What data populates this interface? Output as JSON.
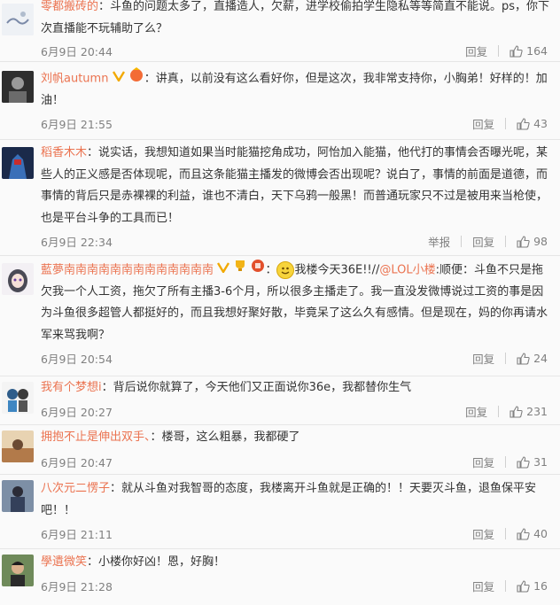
{
  "comments": [
    {
      "user": "零都搬砖的",
      "text": "：斗鱼的问题太多了，直播造人，欠薪，进学校偷拍学生隐私等等简直不能说。ps，你下次直播能不玩辅助了么？",
      "date": "6月9日 20:44",
      "report": "",
      "reply": "回复",
      "likes": "164"
    },
    {
      "user": "刘帆autumn",
      "text": "：讲真，以前没有这么看好你，但是这次，我非常支持你，小胸弟！好样的！加油！",
      "date": "6月9日 21:55",
      "report": "",
      "reply": "回复",
      "likes": "43"
    },
    {
      "user": "稻香木木",
      "text": "：说实话，我想知道如果当时能猫挖角成功，阿怡加入能猫，他代打的事情会否曝光呢，某些人的正义感是否体现呢，而且这条能猫主播发的微博会否出现呢？说白了，事情的前面是道德，而事情的背后只是赤裸裸的利益，谁也不清白，天下乌鸦一般黑！而普通玩家只不过是被用来当枪使，也是平台斗争的工具而已！",
      "date": "6月9日 22:34",
      "report": "举报",
      "reply": "回复",
      "likes": "98"
    },
    {
      "user": "藍夢南南南南南南南南南南南南南",
      "pre": "：",
      "text_a": "我楼今天36E!!//",
      "mention": "@LOL小楼",
      "text": ":顺便：斗鱼不只是拖欠我一个人工资，拖欠了所有主播3-6个月，所以很多主播走了。我一直没发微博说过工资的事是因为斗鱼很多超管人都挺好的，而且我想好聚好散，毕竟呆了这么久有感情。但是现在，妈的你再请水军来骂我啊？",
      "date": "6月9日 20:54",
      "report": "",
      "reply": "回复",
      "likes": "24"
    },
    {
      "user": "我有个梦想i",
      "text": "：背后说你就算了，今天他们又正面说你36e，我都替你生气",
      "date": "6月9日 20:27",
      "report": "",
      "reply": "回复",
      "likes": "231"
    },
    {
      "user": "拥抱不止是伸出双手、",
      "text": "：楼哥，这么粗暴，我都硬了",
      "date": "6月9日 20:47",
      "report": "",
      "reply": "回复",
      "likes": "31"
    },
    {
      "user": "八次元二愣子",
      "text": "：就从斗鱼对我智哥的态度，我楼离开斗鱼就是正确的！！天要灭斗鱼，退鱼保平安吧！！",
      "date": "6月9日 21:11",
      "report": "",
      "reply": "回复",
      "likes": "40"
    },
    {
      "user": "學遺微笑",
      "text": "：小楼你好凶！恩，好胸！",
      "date": "6月9日 21:28",
      "report": "",
      "reply": "回复",
      "likes": "16"
    }
  ],
  "colors": {
    "username": "#eb7350",
    "meta": "#808080",
    "text": "#333333"
  }
}
